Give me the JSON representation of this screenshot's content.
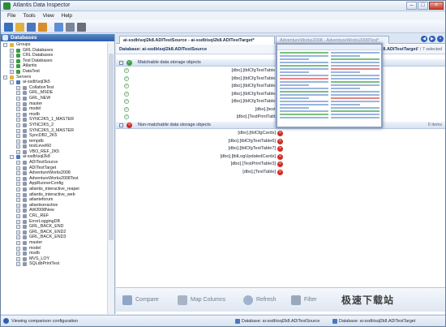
{
  "window": {
    "title": "Atlantis Data Inspector"
  },
  "menu": [
    "File",
    "Tools",
    "View",
    "Help"
  ],
  "left_panel": {
    "title": "Databases",
    "tree": [
      {
        "label": "Groups",
        "indent": 0,
        "icon": "folder-icon",
        "color": "yellow",
        "twisty": "−"
      },
      {
        "label": "GRL Databases",
        "indent": 1,
        "icon": "database-group-icon",
        "color": "green",
        "twisty": "+"
      },
      {
        "label": "CRL Databases",
        "indent": 1,
        "icon": "database-group-icon",
        "color": "green",
        "twisty": "+"
      },
      {
        "label": "Test Databases",
        "indent": 1,
        "icon": "database-group-icon",
        "color": "green",
        "twisty": "+"
      },
      {
        "label": "Atlantis",
        "indent": 1,
        "icon": "database-group-icon",
        "color": "green",
        "twisty": "+"
      },
      {
        "label": "DataTest",
        "indent": 1,
        "icon": "database-group-icon",
        "color": "green",
        "twisty": "+"
      },
      {
        "label": "Servers",
        "indent": 0,
        "icon": "server-folder-icon",
        "color": "yellow",
        "twisty": "−"
      },
      {
        "label": "ai-ssdb\\sql3k5",
        "indent": 1,
        "icon": "server-icon",
        "color": "blue",
        "twisty": "−"
      },
      {
        "label": "CollationTest",
        "indent": 2,
        "icon": "database-icon",
        "color": "gray",
        "twisty": "+"
      },
      {
        "label": "GRL_MSDE",
        "indent": 2,
        "icon": "database-icon",
        "color": "gray",
        "twisty": "+"
      },
      {
        "label": "GRL_NEW",
        "indent": 2,
        "icon": "database-icon",
        "color": "gray",
        "twisty": "+"
      },
      {
        "label": "master",
        "indent": 2,
        "icon": "database-icon",
        "color": "gray",
        "twisty": "+"
      },
      {
        "label": "model",
        "indent": 2,
        "icon": "database-icon",
        "color": "gray",
        "twisty": "+"
      },
      {
        "label": "msdb",
        "indent": 2,
        "icon": "database-icon",
        "color": "gray",
        "twisty": "+"
      },
      {
        "label": "SYNC2K5_1_MASTER",
        "indent": 2,
        "icon": "database-icon",
        "color": "gray",
        "twisty": "+"
      },
      {
        "label": "SYNC2K5_2",
        "indent": 2,
        "icon": "database-icon",
        "color": "gray",
        "twisty": "+"
      },
      {
        "label": "SYNC2K5_3_MASTER",
        "indent": 2,
        "icon": "database-icon",
        "color": "gray",
        "twisty": "+"
      },
      {
        "label": "SyncDB2_2K5",
        "indent": 2,
        "icon": "database-icon",
        "color": "gray",
        "twisty": "+"
      },
      {
        "label": "tempdb",
        "indent": 2,
        "icon": "database-icon",
        "color": "gray",
        "twisty": "+"
      },
      {
        "label": "testLevel60",
        "indent": 2,
        "icon": "database-icon",
        "color": "gray",
        "twisty": "+"
      },
      {
        "label": "VBO_REF_2K5",
        "indent": 2,
        "icon": "database-icon",
        "color": "gray",
        "twisty": "+"
      },
      {
        "label": "ai-ssdb\\sql2k8",
        "indent": 1,
        "icon": "server-icon",
        "color": "blue",
        "twisty": "−"
      },
      {
        "label": "ADITestSource",
        "indent": 2,
        "icon": "database-icon",
        "color": "gray",
        "twisty": "+"
      },
      {
        "label": "ADITestTarget",
        "indent": 2,
        "icon": "database-icon",
        "color": "gray",
        "twisty": "+"
      },
      {
        "label": "AdventureWorks2008",
        "indent": 2,
        "icon": "database-icon",
        "color": "gray",
        "twisty": "+"
      },
      {
        "label": "AdventureWorks2008Test",
        "indent": 2,
        "icon": "database-icon",
        "color": "gray",
        "twisty": "+"
      },
      {
        "label": "AppRunnerConfig",
        "indent": 2,
        "icon": "database-icon",
        "color": "gray",
        "twisty": "+"
      },
      {
        "label": "atlantis_interactive_reaper",
        "indent": 2,
        "icon": "database-icon",
        "color": "gray",
        "twisty": "+"
      },
      {
        "label": "atlantis_interactive_web",
        "indent": 2,
        "icon": "database-icon",
        "color": "gray",
        "twisty": "+"
      },
      {
        "label": "atlanteforum",
        "indent": 2,
        "icon": "database-icon",
        "color": "gray",
        "twisty": "+"
      },
      {
        "label": "atlantiseractive",
        "indent": 2,
        "icon": "database-icon",
        "color": "gray",
        "twisty": "+"
      },
      {
        "label": "AW2008New",
        "indent": 2,
        "icon": "database-icon",
        "color": "gray",
        "twisty": "+"
      },
      {
        "label": "CRL_REF",
        "indent": 2,
        "icon": "database-icon",
        "color": "gray",
        "twisty": "+"
      },
      {
        "label": "ErrorLoggingDB",
        "indent": 2,
        "icon": "database-icon",
        "color": "gray",
        "twisty": "+"
      },
      {
        "label": "GRL_BACK_END",
        "indent": 2,
        "icon": "database-icon",
        "color": "gray",
        "twisty": "+"
      },
      {
        "label": "GRL_BACK_END2",
        "indent": 2,
        "icon": "database-icon",
        "color": "gray",
        "twisty": "+"
      },
      {
        "label": "GRL_BACK_END3",
        "indent": 2,
        "icon": "database-icon",
        "color": "gray",
        "twisty": "+"
      },
      {
        "label": "master",
        "indent": 2,
        "icon": "database-icon",
        "color": "gray",
        "twisty": "+"
      },
      {
        "label": "model",
        "indent": 2,
        "icon": "database-icon",
        "color": "gray",
        "twisty": "+"
      },
      {
        "label": "msdb",
        "indent": 2,
        "icon": "database-icon",
        "color": "gray",
        "twisty": "+"
      },
      {
        "label": "MVS_LOY",
        "indent": 2,
        "icon": "database-icon",
        "color": "gray",
        "twisty": "+"
      },
      {
        "label": "SQLdbPrintTest",
        "indent": 2,
        "icon": "database-icon",
        "color": "gray",
        "twisty": "+"
      }
    ]
  },
  "tabs": {
    "active": "ai-ssdb\\sql2k8.ADITestSource - ai-ssdb\\sql2k8.ADITestTarget*",
    "inactive": "AdventureWorks2008 - AdventureWorks2008Test*"
  },
  "db_header": {
    "source": "Database: ai-ssdb\\sql2k8.ADITestSource",
    "target": "sql2k8.ADITestTarget",
    "selection": "7 / 7 selected"
  },
  "matchable": {
    "title": "Matchable data storage objects",
    "items": [
      "[dbo].[tblCfgTestTable1]",
      "[dbo].[tblCfgTestTable2]",
      "[dbo].[tblCfgTestTable3]",
      "[dbo].[tblCfgTestTable4]",
      "[dbo].[tblCfgTestTable5]",
      "[dbo].[test1]",
      "[dbo].[TestPrintTable]"
    ]
  },
  "non_matchable": {
    "title": "Non-matchable data storage objects",
    "count": "6 items",
    "items": [
      "[dbo].[tblCfgCards]",
      "[dbo].[tblCfgTestTable6]",
      "[dbo].[tblCfgTestTable7]",
      "[dbo].[tblLogUpdatedCards]",
      "[dbo].[TestPrintTable3]",
      "[dbo].[TestTable]"
    ]
  },
  "bottom_actions": [
    "Compare",
    "Map Columns",
    "Refresh",
    "Filter"
  ],
  "watermark": "极速下载站",
  "status": {
    "message": "Viewing comparison configuration",
    "source": "Database: ai-ssdb\\sql2k8.ADITestSource",
    "target": "Database: ai-ssdb\\sql2k8.ADITestTarget"
  },
  "colors": {
    "header_blue": "#2c5ea8",
    "ok_green": "#3aa043",
    "error_red": "#cf2d24"
  }
}
